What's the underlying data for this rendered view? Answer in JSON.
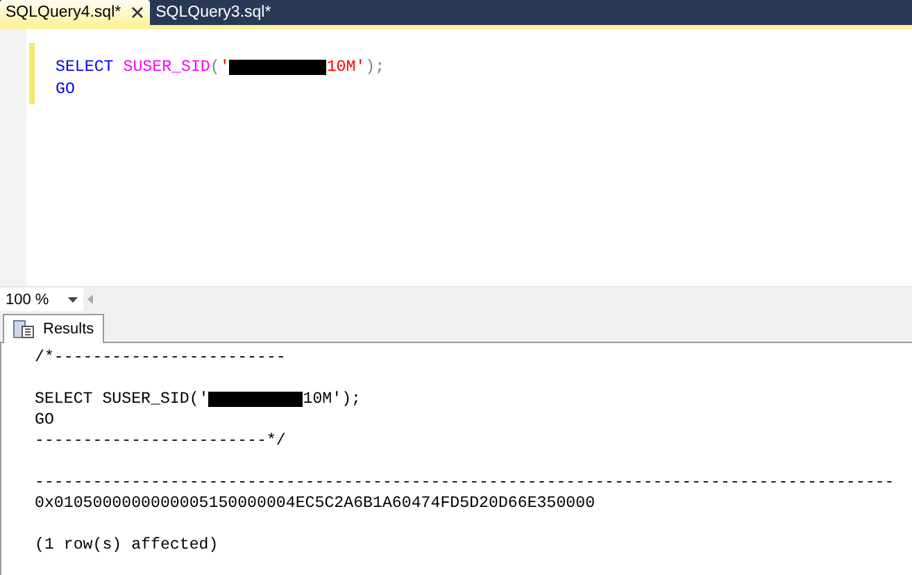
{
  "tabs": [
    {
      "label": "SQLQuery4.sql*",
      "selected": true,
      "closable": true
    },
    {
      "label": "SQLQuery3.sql*",
      "selected": false,
      "closable": false
    }
  ],
  "editor": {
    "lines": [
      [
        {
          "kind": "keyword",
          "text": "SELECT"
        },
        {
          "kind": "function",
          "text": "SUSER_SID",
          "space_before": true
        },
        {
          "kind": "punct",
          "text": "("
        },
        {
          "kind": "string",
          "text": "'"
        },
        {
          "kind": "redacted"
        },
        {
          "kind": "string",
          "text": "10M'"
        },
        {
          "kind": "punct",
          "text": ");"
        }
      ],
      [
        {
          "kind": "keyword",
          "text": "GO"
        }
      ]
    ]
  },
  "zoom": {
    "value": "100 %"
  },
  "results_tabs": [
    {
      "label": "Results",
      "selected": true
    }
  ],
  "results": {
    "lines": [
      [
        {
          "kind": "text",
          "text": "/*------------------------"
        }
      ],
      [
        {
          "kind": "blank"
        }
      ],
      [
        {
          "kind": "text",
          "text": "SELECT SUSER_SID('"
        },
        {
          "kind": "redacted"
        },
        {
          "kind": "text",
          "text": "10M');"
        }
      ],
      [
        {
          "kind": "text",
          "text": "GO"
        }
      ],
      [
        {
          "kind": "text",
          "text": "------------------------*/"
        }
      ],
      [
        {
          "kind": "blank"
        }
      ],
      [
        {
          "kind": "text",
          "text": "-----------------------------------------------------------------------------------------"
        }
      ],
      [
        {
          "kind": "text",
          "text": "0x0105000000000005150000004EC5C2A6B1A60474FD5D20D66E350000"
        }
      ],
      [
        {
          "kind": "blank"
        }
      ],
      [
        {
          "kind": "text",
          "text": "(1 row(s) affected)"
        }
      ]
    ]
  }
}
